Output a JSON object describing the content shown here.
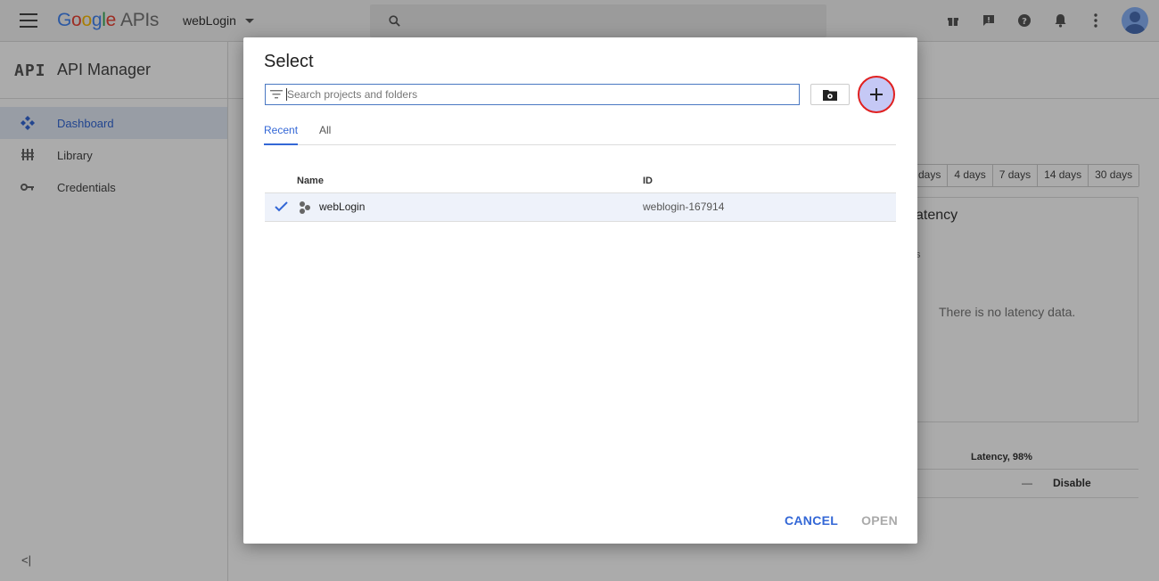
{
  "topbar": {
    "logo_letters": [
      "G",
      "o",
      "o",
      "g",
      "l",
      "e"
    ],
    "logo_suffix": "APIs",
    "project": "webLogin",
    "icons": [
      "gift-icon",
      "feedback-icon",
      "help-icon",
      "notifications-icon",
      "more-vert-icon",
      "avatar"
    ]
  },
  "sidebar": {
    "badge": "API",
    "title": "API Manager",
    "items": [
      {
        "label": "Dashboard",
        "icon": "dashboard-icon",
        "active": true
      },
      {
        "label": "Library",
        "icon": "library-icon",
        "active": false
      },
      {
        "label": "Credentials",
        "icon": "key-icon",
        "active": false
      }
    ],
    "collapse_label": "<|"
  },
  "background": {
    "ranges": [
      "days",
      "4 days",
      "7 days",
      "14 days",
      "30 days"
    ],
    "latency_title": "atency",
    "latency_sub": "s",
    "latency_empty": "There is no latency data.",
    "table_header": "Latency, 98%",
    "row_value": "—",
    "row_action": "Disable"
  },
  "dialog": {
    "title": "Select",
    "search_placeholder": "Search projects and folders",
    "tabs": [
      {
        "label": "Recent",
        "active": true
      },
      {
        "label": "All",
        "active": false
      }
    ],
    "columns": {
      "name": "Name",
      "id": "ID"
    },
    "rows": [
      {
        "name": "webLogin",
        "id": "weblogin-167914",
        "selected": true
      }
    ],
    "cancel_label": "CANCEL",
    "open_label": "OPEN",
    "add_label": "+"
  },
  "colors": {
    "accent": "#3367d6",
    "highlight_ring": "#e02020",
    "add_button_fill": "#c5c8f5"
  }
}
